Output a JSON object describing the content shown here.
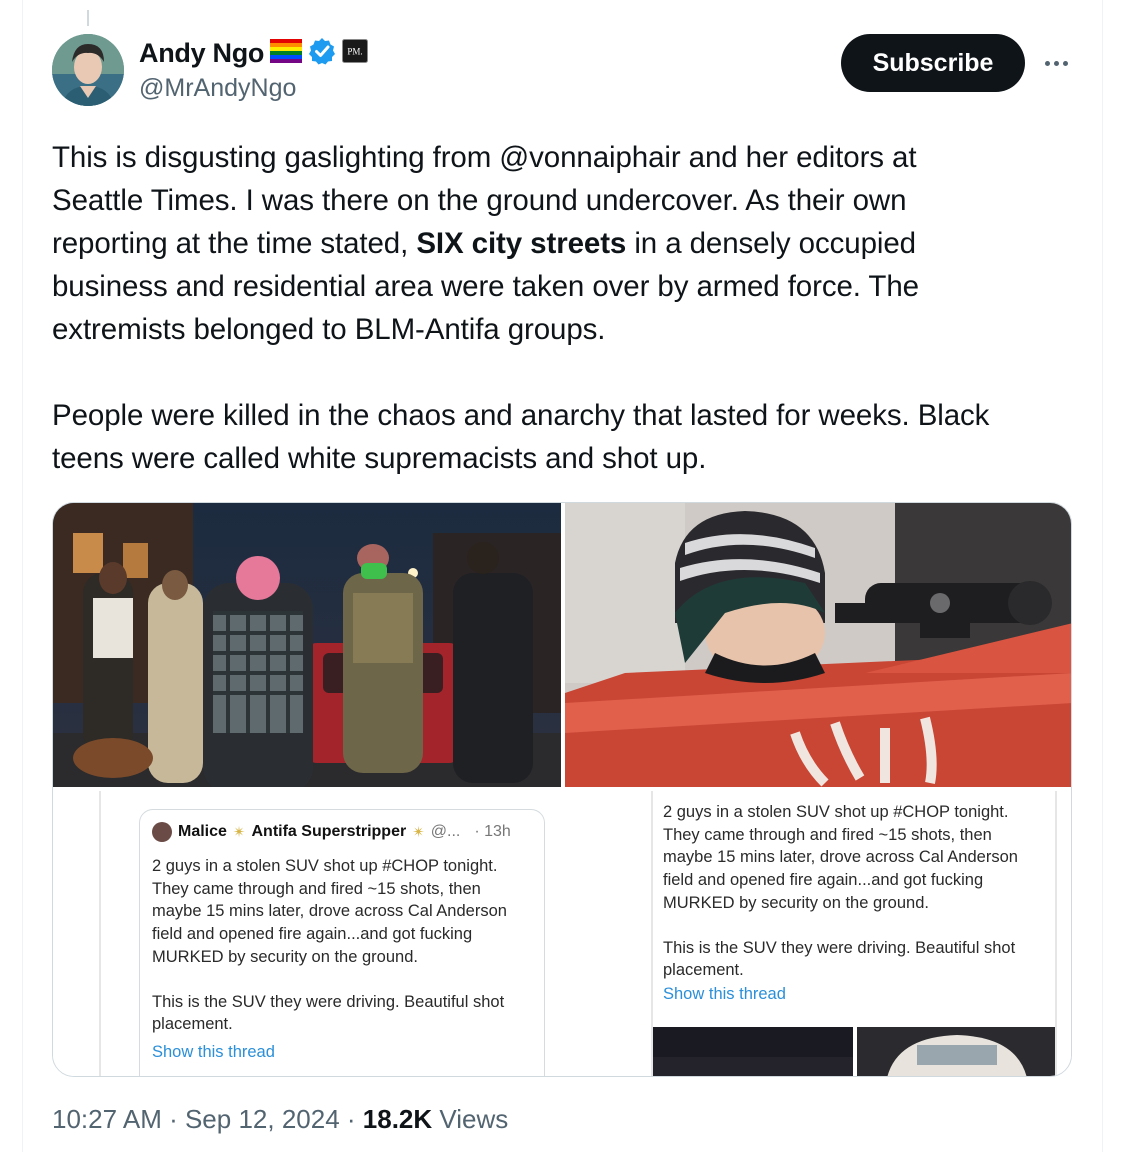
{
  "author": {
    "name": "Andy Ngo",
    "handle": "@MrAndyNgo",
    "badge_text": "PM."
  },
  "actions": {
    "subscribe_label": "Subscribe"
  },
  "tweet": {
    "lines_p1": [
      "This is disgusting gaslighting from @vonnaiphair and her editors at",
      "Seattle Times. I was there on the ground undercover. As their own"
    ],
    "line3_before": "reporting at the time stated, ",
    "line3_bold": "SIX city streets",
    "line3_after": " in a densely occupied",
    "lines_p1_end": [
      "business and residential area were taken over by armed force. The",
      "extremists belonged to BLM-Antifa groups."
    ],
    "lines_p2": [
      "People were killed in the chaos and anarchy that lasted for weeks. Black",
      "teens were called white supremacists and shot up."
    ]
  },
  "embedded_post": {
    "author_name": "Malice",
    "author_name2": "Antifa Superstripper",
    "handle": "@...",
    "time": "· 13h",
    "body_p1": [
      "2 guys in a stolen SUV shot up #CHOP tonight.",
      "They came through and fired ~15 shots, then",
      "maybe 15 mins later, drove across Cal Anderson",
      "field and opened fire again...and got fucking",
      "MURKED by security on the ground."
    ],
    "body_p2": [
      "This is the SUV they were driving. Beautiful shot",
      "placement."
    ],
    "thread_link": "Show this thread"
  },
  "embedded_post_right": {
    "body_p1": [
      "2 guys in a stolen SUV shot up #CHOP tonight.",
      "They came through and fired ~15 shots, then",
      "maybe 15 mins later, drove across Cal Anderson",
      "field and opened fire again...and got fucking",
      "MURKED by security on the ground."
    ],
    "body_p2": [
      "This is the SUV they were driving. Beautiful shot",
      "placement."
    ],
    "thread_link": "Show this thread"
  },
  "footer": {
    "time": "10:27 AM",
    "sep1": " · ",
    "date": "Sep 12, 2024",
    "sep2": " · ",
    "views_count": "18.2K",
    "views_label": " Views"
  },
  "icons": {
    "verified": "verified-badge-icon",
    "flag": "rainbow-flag-icon",
    "more": "more-options-icon"
  },
  "colors": {
    "text": "#0f1419",
    "secondary": "#536471",
    "verified": "#1d9bf0",
    "button": "#0f1419",
    "link": "#2b8fd9"
  }
}
